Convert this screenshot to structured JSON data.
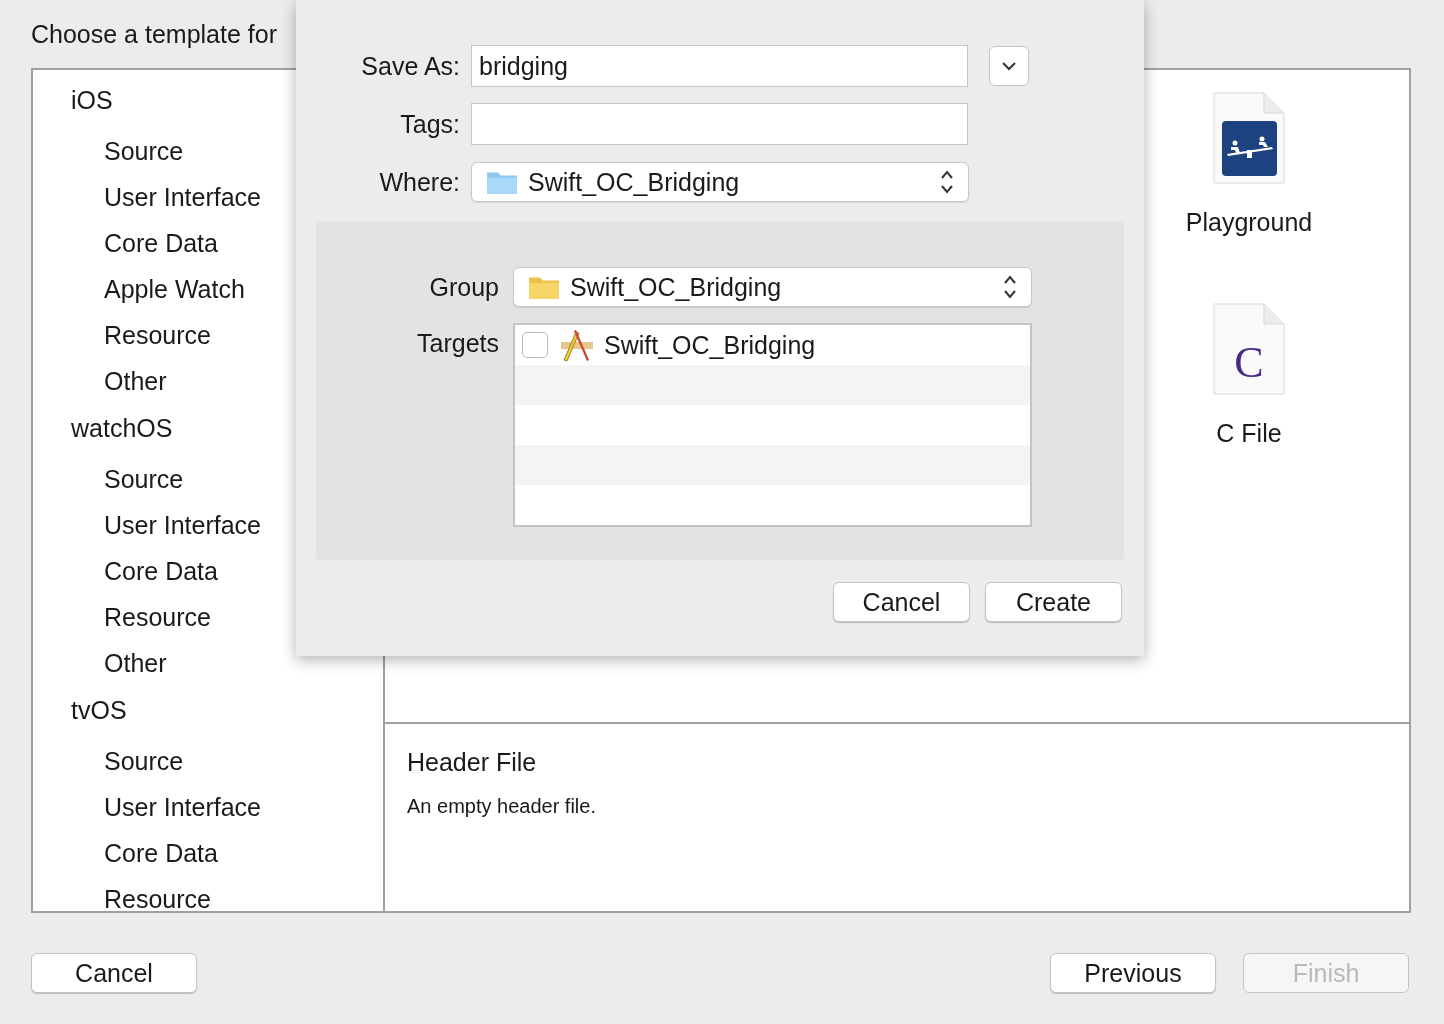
{
  "title": "Choose a template for",
  "sidebar": {
    "sections": [
      {
        "label": "iOS",
        "items": [
          "Source",
          "User Interface",
          "Core Data",
          "Apple Watch",
          "Resource",
          "Other"
        ]
      },
      {
        "label": "watchOS",
        "items": [
          "Source",
          "User Interface",
          "Core Data",
          "Resource",
          "Other"
        ]
      },
      {
        "label": "tvOS",
        "items": [
          "Source",
          "User Interface",
          "Core Data",
          "Resource"
        ]
      }
    ]
  },
  "templates": [
    {
      "label": "Playground",
      "kind": "playground"
    },
    {
      "label": "C File",
      "kind": "c",
      "glyph": "C"
    }
  ],
  "description": {
    "title": "Header File",
    "text": "An empty header file."
  },
  "buttons": [
    {
      "label": "Cancel",
      "disabled": false
    },
    {
      "label": "Previous",
      "disabled": false
    },
    {
      "label": "Finish",
      "disabled": true
    }
  ],
  "sheet": {
    "save_as": {
      "label": "Save As:",
      "value": "bridging"
    },
    "tags": {
      "label": "Tags:"
    },
    "where": {
      "label": "Where:",
      "value": "Swift_OC_Bridging"
    },
    "group": {
      "label": "Group",
      "value": "Swift_OC_Bridging"
    },
    "targets": {
      "label": "Targets",
      "rows": [
        {
          "name": "Swift_OC_Bridging",
          "checked": false
        }
      ]
    },
    "buttons": [
      {
        "label": "Cancel"
      },
      {
        "label": "Create"
      }
    ]
  }
}
